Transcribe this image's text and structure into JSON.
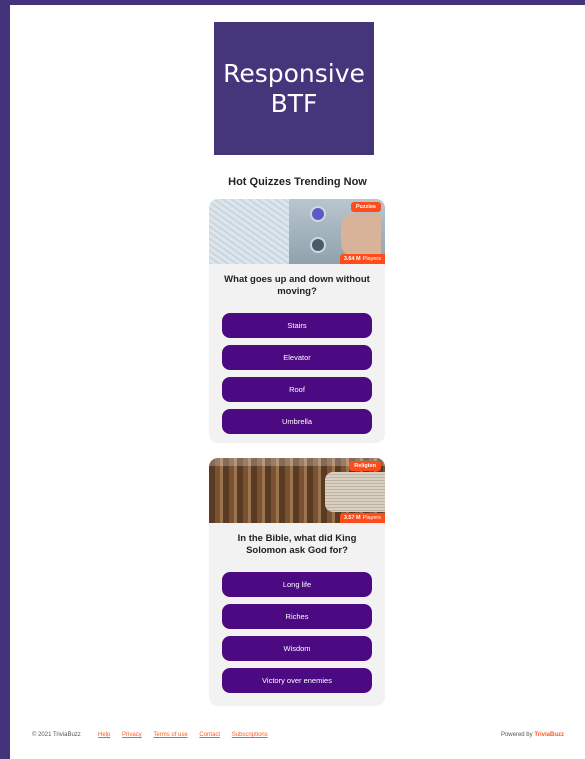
{
  "ad": {
    "line1": "Responsive",
    "line2": "BTF"
  },
  "section_title": "Hot Quizzes Trending Now",
  "quizzes": [
    {
      "category": "Puzzles",
      "players_count": "3.64 M",
      "players_label": "Players",
      "question": "What goes up and down without moving?",
      "answers": [
        "Stairs",
        "Elevator",
        "Roof",
        "Umbrella"
      ]
    },
    {
      "category": "Religion",
      "players_count": "3.57 M",
      "players_label": "Players",
      "question": "In the Bible, what did King Solomon ask God for?",
      "answers": [
        "Long life",
        "Riches",
        "Wisdom",
        "Victory over enemies"
      ]
    }
  ],
  "footer": {
    "copyright": "© 2021 TriviaBuzz",
    "links": [
      "Help",
      "Privacy",
      "Terms of use",
      "Contact",
      "Subscriptions"
    ],
    "powered_by": "Powered by",
    "brand": "TriviaBuzz"
  },
  "colors": {
    "background": "#43337a",
    "ad_bg": "#45357b",
    "answer_button": "#4b0a82",
    "accent": "#ff4c1a"
  }
}
